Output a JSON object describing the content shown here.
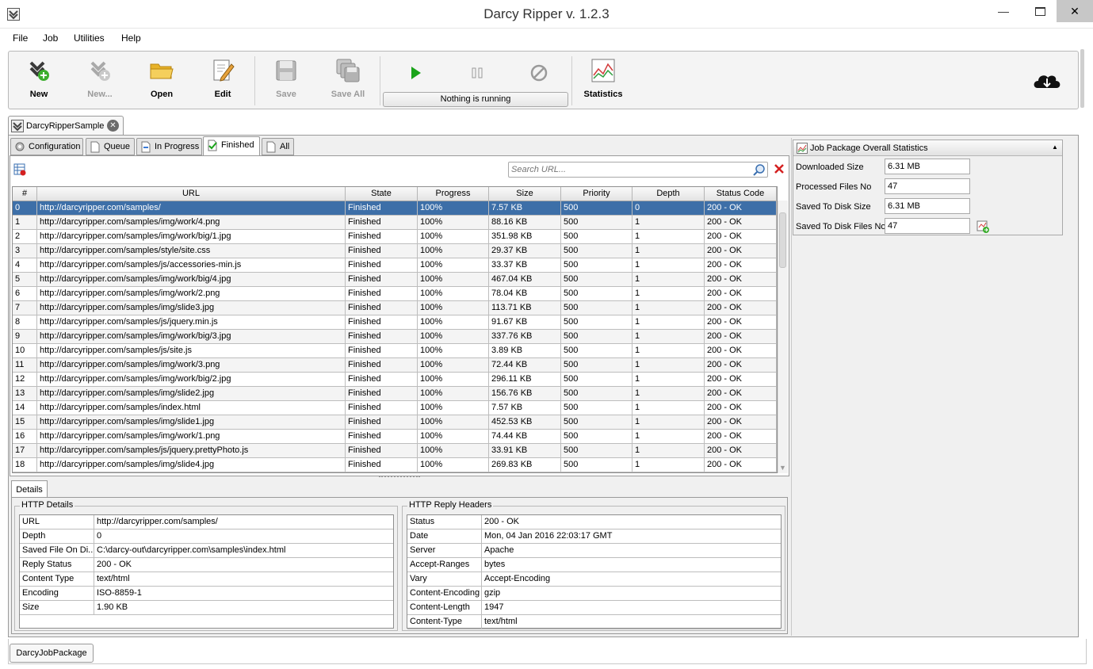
{
  "window": {
    "title": "Darcy Ripper v. 1.2.3"
  },
  "menu": [
    "File",
    "Job",
    "Utilities",
    "Help"
  ],
  "toolbar": {
    "new": "New",
    "new_from": "New...",
    "open": "Open",
    "edit": "Edit",
    "save": "Save",
    "save_all": "Save All",
    "run_status": "Nothing is running",
    "statistics": "Statistics"
  },
  "job_tab": {
    "label": "DarcyRipperSample"
  },
  "subtabs": [
    "Configuration",
    "Queue",
    "In Progress",
    "Finished",
    "All"
  ],
  "search": {
    "placeholder": "Search URL..."
  },
  "table": {
    "columns": [
      "#",
      "URL",
      "State",
      "Progress",
      "Size",
      "Priority",
      "Depth",
      "Status Code"
    ],
    "rows": [
      [
        "0",
        "http://darcyripper.com/samples/",
        "Finished",
        "100%",
        "7.57 KB",
        "500",
        "0",
        "200 - OK"
      ],
      [
        "1",
        "http://darcyripper.com/samples/img/work/4.png",
        "Finished",
        "100%",
        "88.16 KB",
        "500",
        "1",
        "200 - OK"
      ],
      [
        "2",
        "http://darcyripper.com/samples/img/work/big/1.jpg",
        "Finished",
        "100%",
        "351.98 KB",
        "500",
        "1",
        "200 - OK"
      ],
      [
        "3",
        "http://darcyripper.com/samples/style/site.css",
        "Finished",
        "100%",
        "29.37 KB",
        "500",
        "1",
        "200 - OK"
      ],
      [
        "4",
        "http://darcyripper.com/samples/js/accessories-min.js",
        "Finished",
        "100%",
        "33.37 KB",
        "500",
        "1",
        "200 - OK"
      ],
      [
        "5",
        "http://darcyripper.com/samples/img/work/big/4.jpg",
        "Finished",
        "100%",
        "467.04 KB",
        "500",
        "1",
        "200 - OK"
      ],
      [
        "6",
        "http://darcyripper.com/samples/img/work/2.png",
        "Finished",
        "100%",
        "78.04 KB",
        "500",
        "1",
        "200 - OK"
      ],
      [
        "7",
        "http://darcyripper.com/samples/img/slide3.jpg",
        "Finished",
        "100%",
        "113.71 KB",
        "500",
        "1",
        "200 - OK"
      ],
      [
        "8",
        "http://darcyripper.com/samples/js/jquery.min.js",
        "Finished",
        "100%",
        "91.67 KB",
        "500",
        "1",
        "200 - OK"
      ],
      [
        "9",
        "http://darcyripper.com/samples/img/work/big/3.jpg",
        "Finished",
        "100%",
        "337.76 KB",
        "500",
        "1",
        "200 - OK"
      ],
      [
        "10",
        "http://darcyripper.com/samples/js/site.js",
        "Finished",
        "100%",
        "3.89 KB",
        "500",
        "1",
        "200 - OK"
      ],
      [
        "11",
        "http://darcyripper.com/samples/img/work/3.png",
        "Finished",
        "100%",
        "72.44 KB",
        "500",
        "1",
        "200 - OK"
      ],
      [
        "12",
        "http://darcyripper.com/samples/img/work/big/2.jpg",
        "Finished",
        "100%",
        "296.11 KB",
        "500",
        "1",
        "200 - OK"
      ],
      [
        "13",
        "http://darcyripper.com/samples/img/slide2.jpg",
        "Finished",
        "100%",
        "156.76 KB",
        "500",
        "1",
        "200 - OK"
      ],
      [
        "14",
        "http://darcyripper.com/samples/index.html",
        "Finished",
        "100%",
        "7.57 KB",
        "500",
        "1",
        "200 - OK"
      ],
      [
        "15",
        "http://darcyripper.com/samples/img/slide1.jpg",
        "Finished",
        "100%",
        "452.53 KB",
        "500",
        "1",
        "200 - OK"
      ],
      [
        "16",
        "http://darcyripper.com/samples/img/work/1.png",
        "Finished",
        "100%",
        "74.44 KB",
        "500",
        "1",
        "200 - OK"
      ],
      [
        "17",
        "http://darcyripper.com/samples/js/jquery.prettyPhoto.js",
        "Finished",
        "100%",
        "33.91 KB",
        "500",
        "1",
        "200 - OK"
      ],
      [
        "18",
        "http://darcyripper.com/samples/img/slide4.jpg",
        "Finished",
        "100%",
        "269.83 KB",
        "500",
        "1",
        "200 - OK"
      ]
    ]
  },
  "details": {
    "tab_label": "Details",
    "http_details": {
      "title": "HTTP Details",
      "rows": [
        [
          "URL",
          "http://darcyripper.com/samples/"
        ],
        [
          "Depth",
          "0"
        ],
        [
          "Saved File On Di...",
          "C:\\darcy-out\\darcyripper.com\\samples\\index.html"
        ],
        [
          "Reply Status",
          "200 - OK"
        ],
        [
          "Content Type",
          "text/html"
        ],
        [
          "Encoding",
          "ISO-8859-1"
        ],
        [
          "Size",
          "1.90 KB"
        ]
      ]
    },
    "reply_headers": {
      "title": "HTTP Reply Headers",
      "rows": [
        [
          "Status",
          "200 - OK"
        ],
        [
          "Date",
          "Mon, 04 Jan 2016 22:03:17 GMT"
        ],
        [
          "Server",
          "Apache"
        ],
        [
          "Accept-Ranges",
          "bytes"
        ],
        [
          "Vary",
          "Accept-Encoding"
        ],
        [
          "Content-Encoding",
          "gzip"
        ],
        [
          "Content-Length",
          "1947"
        ],
        [
          "Content-Type",
          "text/html"
        ]
      ]
    }
  },
  "stats": {
    "title": "Job Package Overall Statistics",
    "items": [
      {
        "label": "Downloaded Size",
        "value": "6.31 MB"
      },
      {
        "label": "Processed Files No",
        "value": "47"
      },
      {
        "label": "Saved To Disk Size",
        "value": "6.31 MB"
      },
      {
        "label": "Saved To Disk Files No",
        "value": "47"
      }
    ]
  },
  "package_tab": {
    "label": "DarcyJobPackage"
  },
  "colors": {
    "selection": "#3d6fa8",
    "run_green": "#1aa31a",
    "clear_red": "#d42020"
  }
}
